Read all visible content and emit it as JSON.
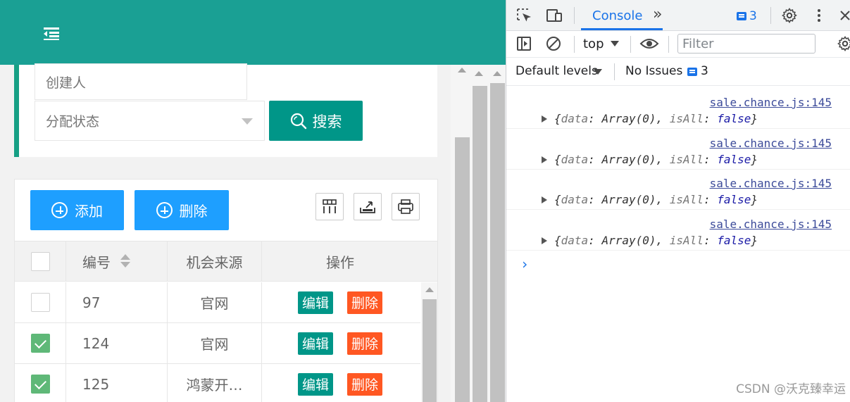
{
  "app": {
    "header": {
      "menu_icon": "menu-fold-icon"
    },
    "search": {
      "creator_placeholder": "创建人",
      "status_placeholder": "分配状态",
      "search_button": "搜索"
    },
    "toolbar": {
      "add_label": "添加",
      "delete_label": "删除",
      "icons": [
        "columns-icon",
        "export-icon",
        "print-icon"
      ]
    },
    "table": {
      "headers": [
        "编号",
        "机会来源",
        "操作"
      ],
      "rows": [
        {
          "id": "97",
          "source": "官网",
          "checked": false,
          "edit": "编辑",
          "del": "删除"
        },
        {
          "id": "124",
          "source": "官网",
          "checked": true,
          "edit": "编辑",
          "del": "删除"
        },
        {
          "id": "125",
          "source": "鸿蒙开…",
          "checked": true,
          "edit": "编辑",
          "del": "删除"
        }
      ]
    }
  },
  "devtools": {
    "tab": "Console",
    "more_tabs": "»",
    "message_count": "3",
    "context": "top",
    "filter_placeholder": "Filter",
    "levels": "Default levels",
    "issues": "No Issues",
    "issues_count": "3",
    "logs": [
      {
        "source": "sale.chance.js:145",
        "k1": "data",
        "v1": "Array(0)",
        "k2": "isAll",
        "v2": "false"
      },
      {
        "source": "sale.chance.js:145",
        "k1": "data",
        "v1": "Array(0)",
        "k2": "isAll",
        "v2": "false"
      },
      {
        "source": "sale.chance.js:145",
        "k1": "data",
        "v1": "Array(0)",
        "k2": "isAll",
        "v2": "false"
      },
      {
        "source": "sale.chance.js:145",
        "k1": "data",
        "v1": "Array(0)",
        "k2": "isAll",
        "v2": "false"
      }
    ],
    "prompt": "›"
  },
  "watermark": "CSDN @沃克臻幸运",
  "colors": {
    "header": "#1aa094",
    "primary": "#009688",
    "blue": "#1e9fff",
    "danger": "#ff5722",
    "checked": "#5fb878"
  }
}
